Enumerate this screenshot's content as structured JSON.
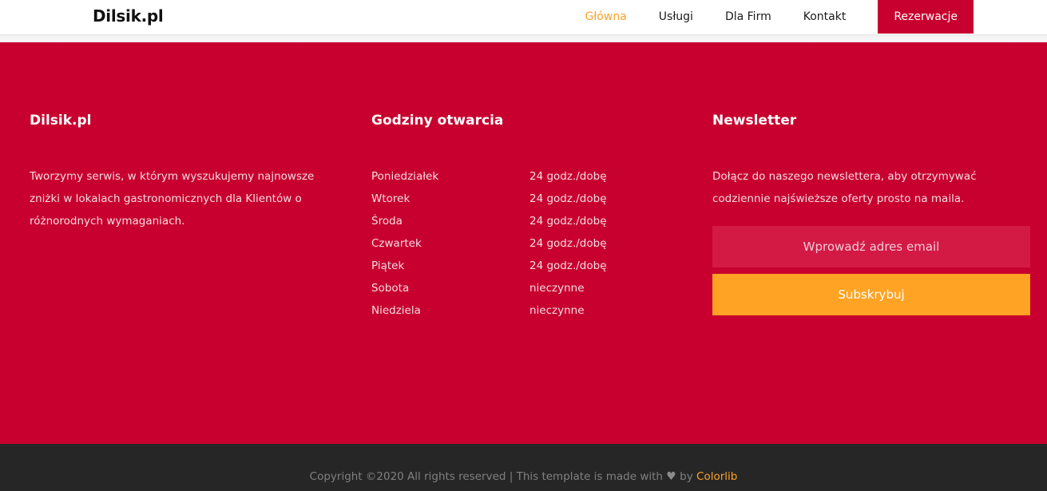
{
  "header": {
    "brand": "Dilsik.pl",
    "nav": [
      {
        "label": "Główna",
        "active": true
      },
      {
        "label": "Usługi",
        "active": false
      },
      {
        "label": "Dla Firm",
        "active": false
      },
      {
        "label": "Kontakt",
        "active": false
      }
    ],
    "cta_label": "Rezerwacje"
  },
  "footer": {
    "about": {
      "title": "Dilsik.pl",
      "text": "Tworzymy serwis, w którym wyszukujemy najnowsze zniżki w lokalach gastronomicznych dla Klientów o różnorodnych wymaganiach."
    },
    "hours": {
      "title": "Godziny otwarcia",
      "rows": [
        {
          "day": "Poniedziałek",
          "value": "24 godz./dobę"
        },
        {
          "day": "Wtorek",
          "value": "24 godz./dobę"
        },
        {
          "day": "Środa",
          "value": "24 godz./dobę"
        },
        {
          "day": "Czwartek",
          "value": "24 godz./dobę"
        },
        {
          "day": "Piątek",
          "value": "24 godz./dobę"
        },
        {
          "day": "Sobota",
          "value": "nieczynne"
        },
        {
          "day": "Niedziela",
          "value": "nieczynne"
        }
      ]
    },
    "newsletter": {
      "title": "Newsletter",
      "text": "Dołącz do naszego newslettera, aby otrzymywać codziennie najświeższe oferty prosto na maila.",
      "email_placeholder": "Wprowadź adres email",
      "email_value": "",
      "subscribe_label": "Subskrybuj"
    },
    "copyright": {
      "prefix": "Copyright ©2020 All rights reserved | This template is made with",
      "heart_icon": "heart-icon",
      "by": "by",
      "link": "Colorlib"
    }
  },
  "colors": {
    "brand_red": "#c8002f",
    "accent_orange": "#fea323",
    "footer_dark": "#262626"
  }
}
